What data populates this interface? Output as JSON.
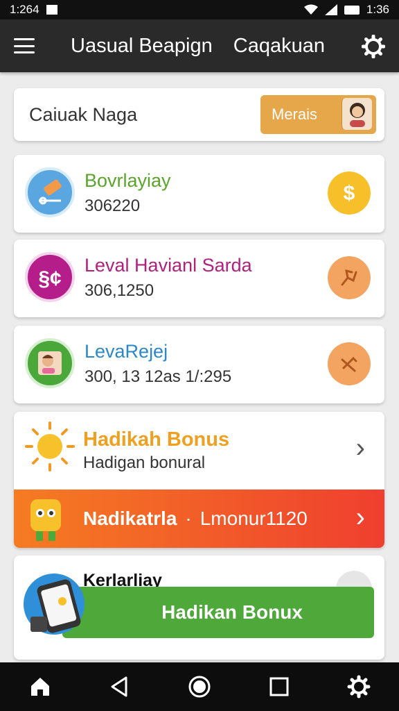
{
  "status_bar": {
    "time_left": "1:264",
    "time_right": "1:36"
  },
  "app_bar": {
    "title": "Uasual Beapign",
    "action": "Caqakuan"
  },
  "profile": {
    "name": "Caiuak Naga",
    "button_label": "Merais"
  },
  "rows": [
    {
      "title": "Bovrlayiay",
      "value": "306220",
      "title_color": "#5aa52a"
    },
    {
      "title": "Leval Havianl Sarda",
      "value": "306,1250",
      "title_color": "#b0207f"
    },
    {
      "title": "LevaRejej",
      "value": "300, 13 12as 1/:295",
      "title_color": "#2a88c8"
    }
  ],
  "bonus": {
    "title": "Hadikah Bonus",
    "subtitle": "Hadigan bonural",
    "banner_text": "Nadikatrla",
    "banner_separator": "·",
    "banner_value": "Lmonur1120"
  },
  "promo": {
    "title": "Kerlarliay",
    "button_label": "Hadikan Bonux"
  },
  "icons": {
    "gear": "gear-icon",
    "menu": "menu-icon",
    "dollar": "dollar-icon",
    "home": "home-icon",
    "back": "back-icon",
    "recents": "recents-icon"
  },
  "colors": {
    "app_bar": "#2a2a2a",
    "banner": "#f04a2c",
    "promo": "#4ea83a",
    "bonus_title": "#f0a020",
    "merais_button": "#e6a64a"
  }
}
